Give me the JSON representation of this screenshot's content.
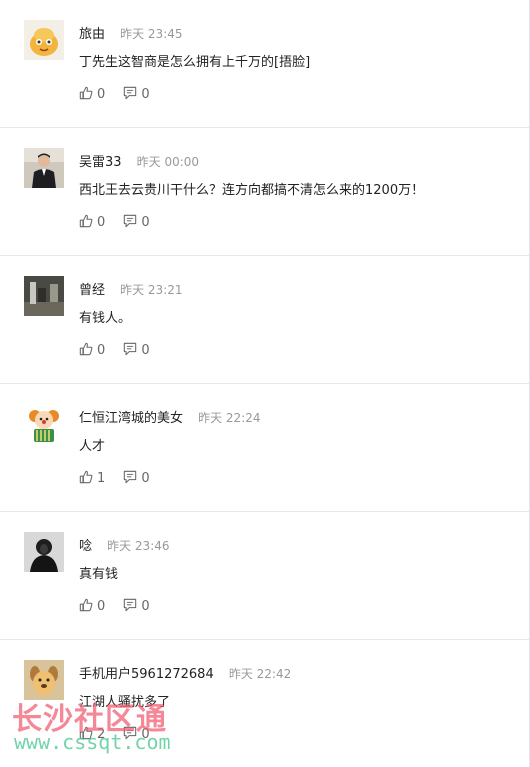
{
  "comments": [
    {
      "user": "旅由",
      "time": "昨天 23:45",
      "text": "丁先生这智商是怎么拥有上千万的[捂脸]",
      "likes": "0",
      "replies": "0",
      "avatar": "bread-cartoon"
    },
    {
      "user": "吴雷33",
      "time": "昨天 00:00",
      "text": "西北王去云贵川干什么？连方向都搞不清怎么来的1200万！",
      "likes": "0",
      "replies": "0",
      "avatar": "man-in-suit"
    },
    {
      "user": "曾经",
      "time": "昨天 23:21",
      "text": "有钱人。",
      "likes": "0",
      "replies": "0",
      "avatar": "dark-room-photo"
    },
    {
      "user": "仁恒江湾城的美女",
      "time": "昨天 22:24",
      "text": "人才",
      "likes": "1",
      "replies": "0",
      "avatar": "clown-cartoon"
    },
    {
      "user": "唸",
      "time": "昨天 23:46",
      "text": "真有钱",
      "likes": "0",
      "replies": "0",
      "avatar": "dark-portrait"
    },
    {
      "user": "手机用户5961272684",
      "time": "昨天 22:42",
      "text": "江湖人骚扰多了",
      "likes": "2",
      "replies": "0",
      "avatar": "dog-cartoon"
    }
  ],
  "watermark": {
    "title": "长沙社区通",
    "url": "www.cssqt.com"
  },
  "colors": {
    "username": "#222222",
    "time": "#999999",
    "action": "#666666",
    "divider": "#e8e8e8"
  }
}
